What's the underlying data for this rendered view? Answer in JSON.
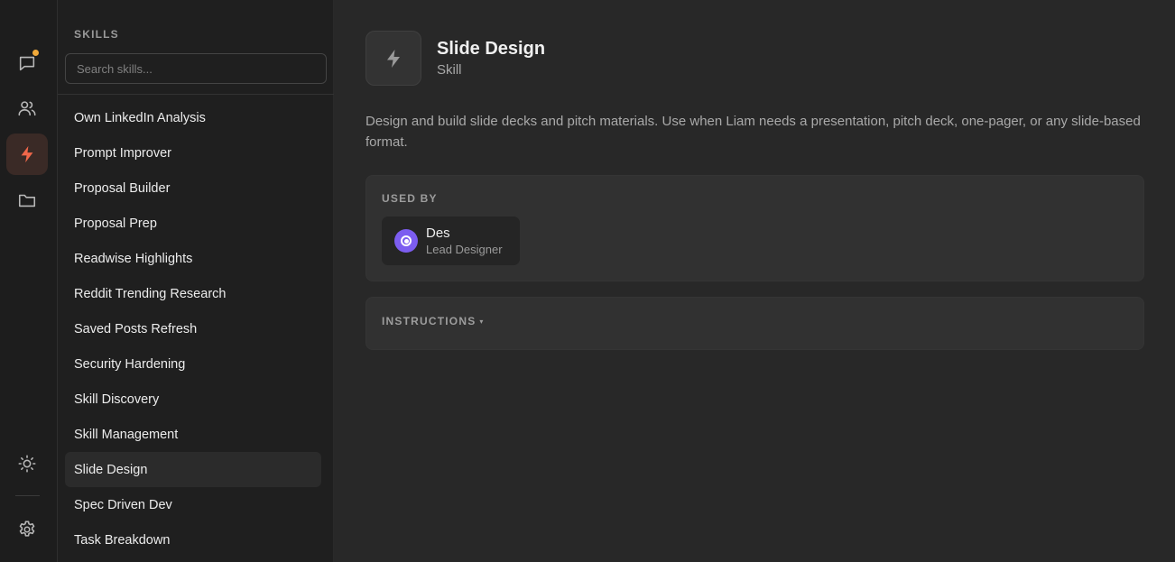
{
  "rail": {
    "items": [
      {
        "icon": "chat-icon",
        "has_notification": true,
        "notification_color": "#f0a93a"
      },
      {
        "icon": "users-icon"
      },
      {
        "icon": "lightning-icon",
        "active": true
      },
      {
        "icon": "folder-icon"
      }
    ],
    "bottom": [
      {
        "icon": "sun-icon"
      },
      {
        "icon": "gear-icon"
      }
    ],
    "active_accent": "#f0674a"
  },
  "skills": {
    "heading": "SKILLS",
    "search_placeholder": "Search skills...",
    "items": [
      {
        "label": "Own LinkedIn Analysis"
      },
      {
        "label": "Prompt Improver"
      },
      {
        "label": "Proposal Builder"
      },
      {
        "label": "Proposal Prep"
      },
      {
        "label": "Readwise Highlights"
      },
      {
        "label": "Reddit Trending Research"
      },
      {
        "label": "Saved Posts Refresh"
      },
      {
        "label": "Security Hardening"
      },
      {
        "label": "Skill Discovery"
      },
      {
        "label": "Skill Management"
      },
      {
        "label": "Slide Design",
        "selected": true
      },
      {
        "label": "Spec Driven Dev"
      },
      {
        "label": "Task Breakdown"
      }
    ]
  },
  "detail": {
    "icon": "lightning-icon",
    "title": "Slide Design",
    "type": "Skill",
    "description": "Design and build slide decks and pitch materials. Use when Liam needs a presentation, pitch deck, one-pager, or any slide-based format.",
    "used_by": {
      "label": "USED BY",
      "agents": [
        {
          "name": "Des",
          "role": "Lead Designer",
          "avatar_color": "#7c5df0"
        }
      ]
    },
    "instructions": {
      "label": "INSTRUCTIONS",
      "caret": "▾"
    }
  }
}
